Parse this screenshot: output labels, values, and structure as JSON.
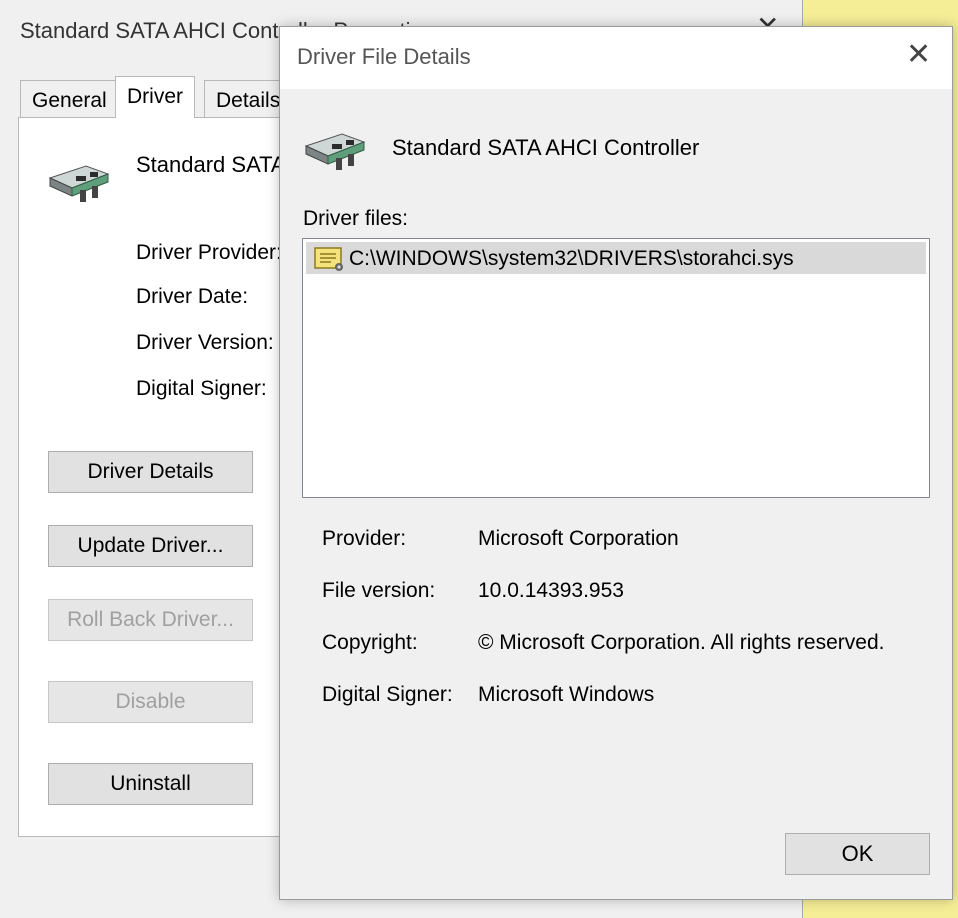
{
  "properties_window": {
    "title": "Standard SATA AHCI Controller Properties",
    "close_glyph": "✕",
    "tabs": [
      {
        "label": "General"
      },
      {
        "label": "Driver"
      },
      {
        "label": "Details"
      }
    ],
    "active_tab": "Driver",
    "device_name": "Standard SATA AHCI Controller",
    "device_icon": "storage-controller-card-icon",
    "field_labels": {
      "provider": "Driver Provider:",
      "date": "Driver Date:",
      "version": "Driver Version:",
      "signer": "Digital Signer:"
    },
    "buttons": {
      "driver_details": "Driver Details",
      "update_driver": "Update Driver...",
      "roll_back": "Roll Back Driver...",
      "disable": "Disable",
      "uninstall": "Uninstall"
    }
  },
  "dialog": {
    "title": "Driver File Details",
    "close_glyph": "✕",
    "device_icon": "storage-controller-card-icon",
    "device_name": "Standard SATA AHCI Controller",
    "driver_files_label": "Driver files:",
    "files": [
      {
        "path": "C:\\WINDOWS\\system32\\DRIVERS\\storahci.sys",
        "icon": "system-file-icon"
      }
    ],
    "labels": {
      "provider": "Provider:",
      "file_version": "File version:",
      "copyright": "Copyright:",
      "digital_signer": "Digital Signer:"
    },
    "values": {
      "provider": "Microsoft Corporation",
      "file_version": "10.0.14393.953",
      "copyright": "© Microsoft Corporation. All rights reserved.",
      "digital_signer": "Microsoft Windows"
    },
    "ok_label": "OK"
  },
  "colors": {
    "window_bg": "#f0f0f0",
    "button_bg": "#e1e1e1",
    "selection": "#d9d9d9",
    "desktop": "#f6ee96"
  }
}
